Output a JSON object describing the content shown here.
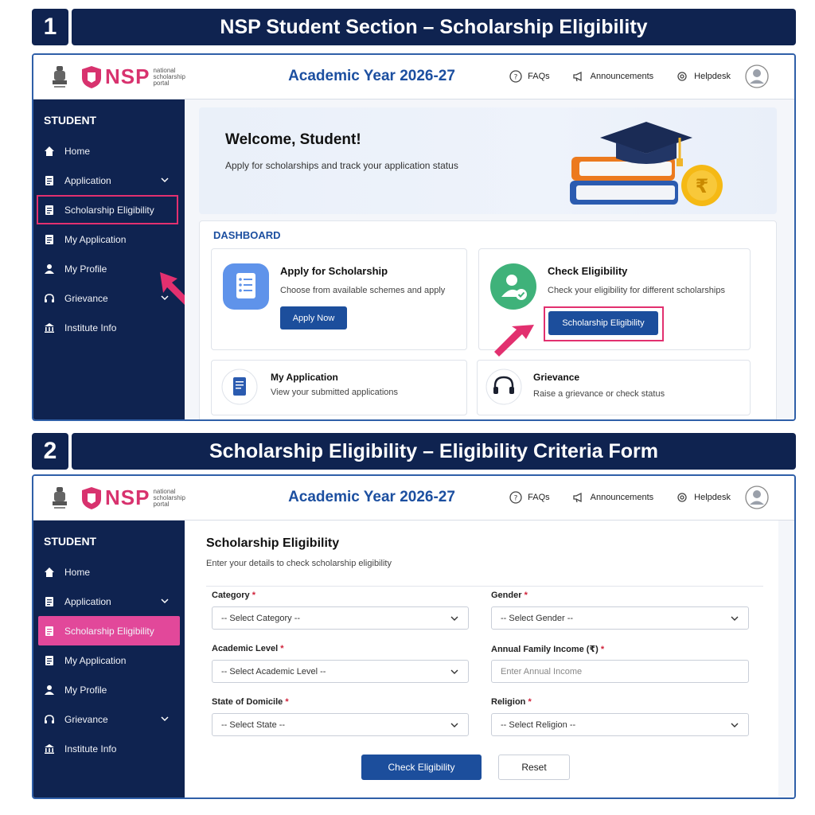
{
  "step1": {
    "number": "1",
    "title": "NSP Student Section – Scholarship Eligibility"
  },
  "step2": {
    "number": "2",
    "title": "Scholarship Eligibility – Eligibility Criteria Form"
  },
  "header": {
    "logo_text": "NSP",
    "logo_sub1": "national",
    "logo_sub2": "scholarship",
    "logo_sub3": "portal",
    "academic_year": "Academic Year 2026-27",
    "links": {
      "faqs": "FAQs",
      "announcements": "Announcements",
      "helpdesk": "Helpdesk"
    }
  },
  "sidebar": {
    "heading": "STUDENT",
    "items": [
      {
        "label": "Home",
        "icon": "home-icon"
      },
      {
        "label": "Application",
        "icon": "document-icon"
      },
      {
        "label": "Scholarship Eligibility",
        "icon": "document-icon"
      },
      {
        "label": "My Application",
        "icon": "document-icon"
      },
      {
        "label": "My Profile",
        "icon": "user-icon"
      },
      {
        "label": "Grievance",
        "icon": "headset-icon"
      },
      {
        "label": "Institute Info",
        "icon": "institution-icon"
      }
    ]
  },
  "welcome": {
    "title": "Welcome, Student!",
    "subtitle": "Apply for scholarships and track your application status"
  },
  "dashboard": {
    "title": "DASHBOARD",
    "apply": {
      "title": "Apply for Scholarship",
      "desc": "Choose from available schemes and apply",
      "button": "Apply Now"
    },
    "check": {
      "title": "Check Eligibility",
      "desc": "Check your eligibility for different scholarships",
      "button": "Scholarship Eligibility"
    },
    "my_app": {
      "title": "My Application",
      "desc": "View your submitted applications"
    },
    "grievance": {
      "title": "Grievance",
      "desc": "Raise a grievance or check status"
    }
  },
  "form": {
    "title": "Scholarship Eligibility",
    "subtitle": "Enter your details to check scholarship eligibility",
    "fields": {
      "category": {
        "label": "Category",
        "value": "-- Select Category --"
      },
      "gender": {
        "label": "Gender",
        "value": "-- Select Gender --"
      },
      "academic_level": {
        "label": "Academic Level",
        "value": "-- Select Academic Level --"
      },
      "income": {
        "label": "Annual Family Income (₹)",
        "placeholder": "Enter Annual Income"
      },
      "state": {
        "label": "State of Domicile",
        "value": "-- Select State --"
      },
      "religion": {
        "label": "Religion",
        "value": "-- Select Religion --"
      }
    },
    "required_mark": "*",
    "check_button": "Check Eligibility",
    "reset_button": "Reset"
  },
  "colors": {
    "navy": "#0f2350",
    "brand_blue": "#1c4e9c",
    "accent_pink": "#e2306f",
    "active_pink": "#e2489a"
  }
}
